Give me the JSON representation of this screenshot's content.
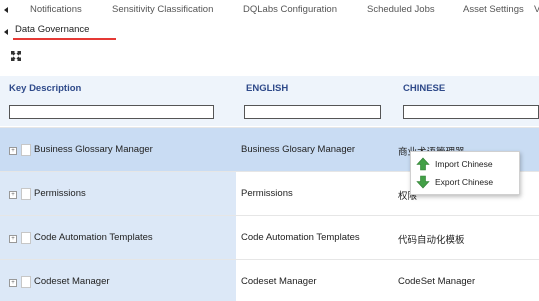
{
  "tabs": {
    "row1": [
      "Notifications",
      "Sensitivity Classification",
      "DQLabs Configuration",
      "Scheduled Jobs",
      "Asset Settings",
      "V"
    ],
    "active": "Data Governance"
  },
  "grid": {
    "columns": [
      "Key Description",
      "ENGLISH",
      "CHINESE"
    ],
    "filters": [
      "",
      "",
      ""
    ],
    "rows": [
      {
        "key": "Business Glossary Manager",
        "english": "Business Glosary Manager",
        "chinese": "商业术语管理器"
      },
      {
        "key": "Permissions",
        "english": "Permissions",
        "chinese": "权限"
      },
      {
        "key": "Code Automation Templates",
        "english": "Code Automation Templates",
        "chinese": "代码自动化模板"
      },
      {
        "key": "Codeset Manager",
        "english": "Codeset Manager",
        "chinese": "CodeSet Manager"
      }
    ]
  },
  "context_menu": {
    "items": [
      {
        "label": "Import Chinese",
        "icon": "arrow-up-icon"
      },
      {
        "label": "Export Chinese",
        "icon": "arrow-down-icon"
      }
    ]
  },
  "colors": {
    "accent_underline": "#e53935",
    "header_text": "#2f4a8a",
    "key_cell_bg": "#dce8f7",
    "selected_row_bg": "#c9dcf3",
    "arrow_green": "#43a047"
  }
}
